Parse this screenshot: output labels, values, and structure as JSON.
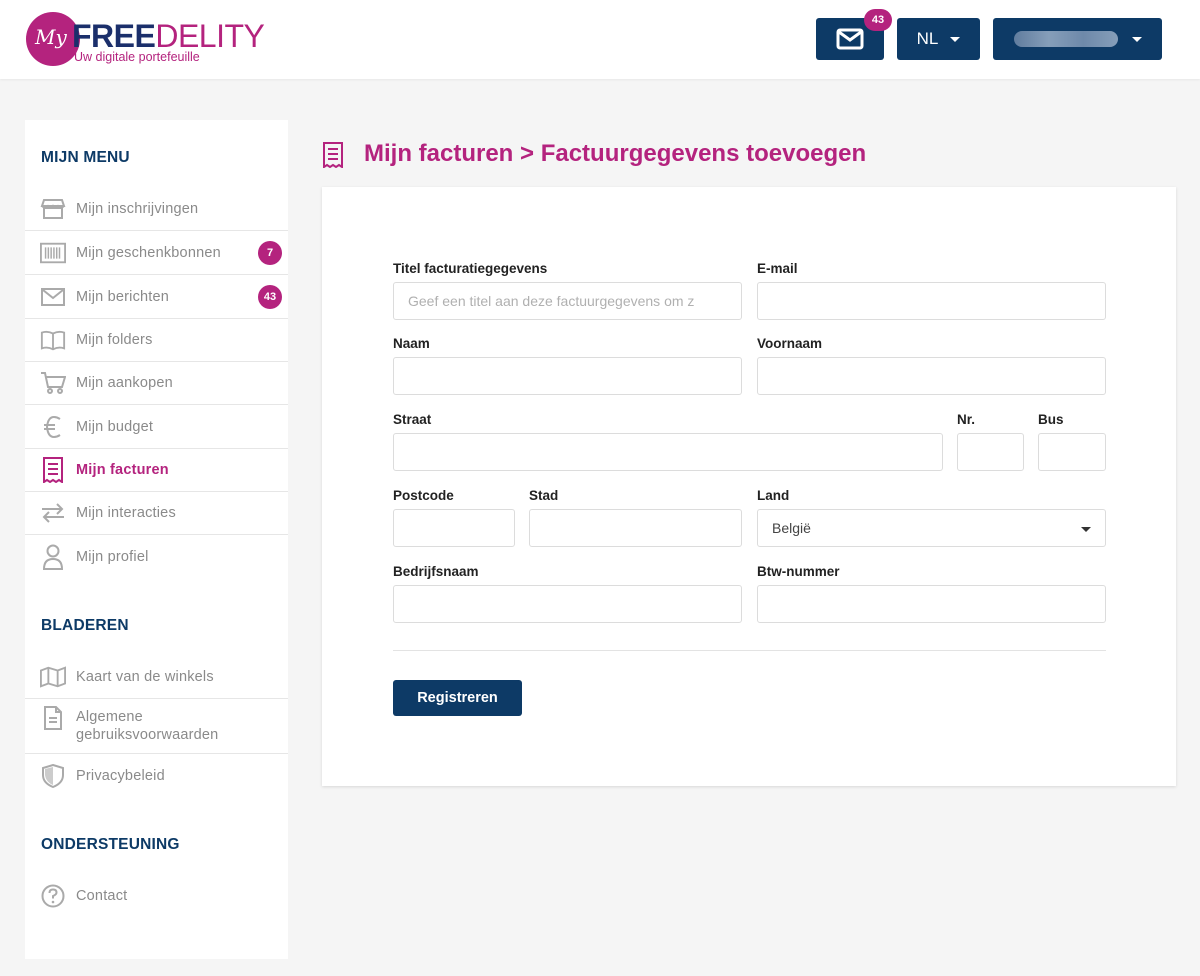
{
  "header": {
    "logo": {
      "prefix": "My",
      "brand_bold": "FREE",
      "brand_light": "DELITY",
      "tagline": "Uw digitale portefeuille"
    },
    "messages_count": "43",
    "language": "NL"
  },
  "sidebar": {
    "menu_title": "MIJN MENU",
    "menu_items": [
      {
        "label": "Mijn inschrijvingen",
        "icon": "store-icon"
      },
      {
        "label": "Mijn geschenkbonnen",
        "icon": "barcode-icon",
        "badge": "7"
      },
      {
        "label": "Mijn berichten",
        "icon": "envelope-icon",
        "badge": "43"
      },
      {
        "label": "Mijn folders",
        "icon": "book-icon"
      },
      {
        "label": "Mijn aankopen",
        "icon": "cart-icon"
      },
      {
        "label": "Mijn budget",
        "icon": "euro-icon"
      },
      {
        "label": "Mijn facturen",
        "icon": "receipt-icon",
        "active": true
      },
      {
        "label": "Mijn interacties",
        "icon": "arrows-icon"
      },
      {
        "label": "Mijn profiel",
        "icon": "user-icon"
      }
    ],
    "browse_title": "BLADEREN",
    "browse_items": [
      {
        "label": "Kaart van de winkels",
        "icon": "map-icon"
      },
      {
        "label": "Algemene gebruiksvoorwaarden",
        "icon": "document-icon"
      },
      {
        "label": "Privacybeleid",
        "icon": "shield-icon"
      }
    ],
    "support_title": "ONDERSTEUNING",
    "support_items": [
      {
        "label": "Contact",
        "icon": "question-icon"
      }
    ]
  },
  "main": {
    "title": "Mijn facturen > Factuurgegevens toevoegen",
    "form": {
      "title_label": "Titel facturatiegegevens",
      "title_placeholder": "Geef een titel aan deze factuurgegevens om z",
      "email_label": "E-mail",
      "naam_label": "Naam",
      "voornaam_label": "Voornaam",
      "straat_label": "Straat",
      "nr_label": "Nr.",
      "bus_label": "Bus",
      "postcode_label": "Postcode",
      "stad_label": "Stad",
      "land_label": "Land",
      "land_value": "België",
      "bedrijf_label": "Bedrijfsnaam",
      "btw_label": "Btw-nummer",
      "submit_label": "Registreren"
    }
  },
  "colors": {
    "brand": "#b4237e",
    "navy": "#0d3a66"
  }
}
